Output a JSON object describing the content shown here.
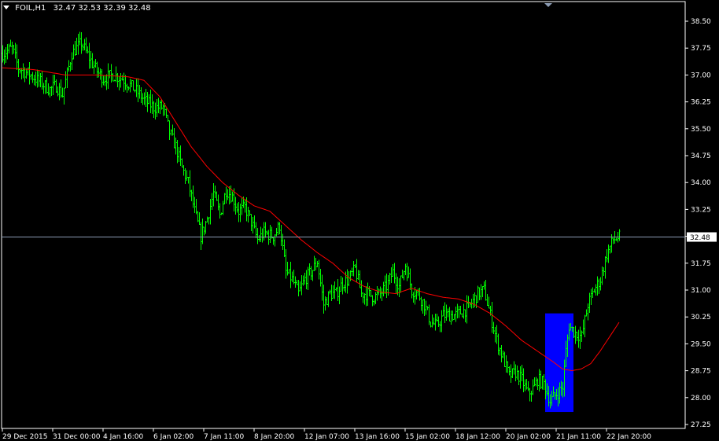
{
  "header": {
    "symbol": "FOIL,H1",
    "ohlc": "32.47 32.53 32.39 32.48"
  },
  "current_price_label": "32.48",
  "chart_data": {
    "type": "bar",
    "title": "FOIL,H1",
    "colors": {
      "bars": "#00ff00",
      "ma": "#ff0000",
      "highlight": "#0000ff",
      "axis": "#ffffff",
      "price_line": "#8c9cb4"
    },
    "y_ticks": [
      "38.50",
      "37.75",
      "37.00",
      "36.25",
      "35.50",
      "34.75",
      "34.00",
      "33.25",
      "32.50",
      "31.75",
      "31.00",
      "30.25",
      "29.50",
      "28.75",
      "28.00",
      "27.25"
    ],
    "y_tick_values": [
      38.5,
      37.75,
      37.0,
      36.25,
      35.5,
      34.75,
      34.0,
      33.25,
      32.5,
      31.75,
      31.0,
      30.25,
      29.5,
      28.75,
      28.0,
      27.25
    ],
    "x_ticks": [
      "29 Dec 2015",
      "31 Dec 00:00",
      "4 Jan 16:00",
      "6 Jan 02:00",
      "7 Jan 11:00",
      "8 Jan 20:00",
      "12 Jan 07:00",
      "13 Jan 16:00",
      "15 Jan 02:00",
      "18 Jan 12:00",
      "20 Jan 02:00",
      "21 Jan 11:00",
      "22 Jan 20:00"
    ],
    "x_tick_bar_index": [
      0,
      32,
      64,
      96,
      128,
      160,
      192,
      224,
      256,
      288,
      320,
      352,
      384
    ],
    "ylim": [
      27.1,
      38.8
    ],
    "current_price": 32.48,
    "price_anchors": [
      [
        0,
        37.6
      ],
      [
        6,
        37.75
      ],
      [
        10,
        37.2
      ],
      [
        16,
        37.05
      ],
      [
        24,
        36.8
      ],
      [
        30,
        36.6
      ],
      [
        34,
        36.7
      ],
      [
        38,
        36.45
      ],
      [
        44,
        37.6
      ],
      [
        50,
        37.9
      ],
      [
        56,
        37.4
      ],
      [
        60,
        37.1
      ],
      [
        64,
        36.9
      ],
      [
        70,
        37.0
      ],
      [
        76,
        36.9
      ],
      [
        84,
        36.6
      ],
      [
        90,
        36.3
      ],
      [
        96,
        36.1
      ],
      [
        102,
        36.1
      ],
      [
        106,
        35.4
      ],
      [
        110,
        35.0
      ],
      [
        114,
        34.4
      ],
      [
        118,
        34.0
      ],
      [
        122,
        33.2
      ],
      [
        126,
        32.5
      ],
      [
        130,
        33.0
      ],
      [
        134,
        33.7
      ],
      [
        138,
        33.1
      ],
      [
        142,
        33.8
      ],
      [
        146,
        33.6
      ],
      [
        150,
        33.2
      ],
      [
        154,
        33.3
      ],
      [
        158,
        32.9
      ],
      [
        162,
        32.4
      ],
      [
        166,
        32.6
      ],
      [
        172,
        32.5
      ],
      [
        176,
        32.8
      ],
      [
        180,
        31.5
      ],
      [
        184,
        31.3
      ],
      [
        188,
        30.9
      ],
      [
        192,
        31.3
      ],
      [
        196,
        31.5
      ],
      [
        200,
        31.8
      ],
      [
        204,
        30.6
      ],
      [
        208,
        30.9
      ],
      [
        212,
        30.9
      ],
      [
        216,
        31.2
      ],
      [
        220,
        31.3
      ],
      [
        224,
        31.6
      ],
      [
        228,
        30.9
      ],
      [
        232,
        30.9
      ],
      [
        236,
        30.8
      ],
      [
        240,
        30.9
      ],
      [
        244,
        31.1
      ],
      [
        248,
        31.5
      ],
      [
        252,
        31.1
      ],
      [
        256,
        31.7
      ],
      [
        260,
        31.0
      ],
      [
        264,
        30.9
      ],
      [
        268,
        30.6
      ],
      [
        272,
        30.1
      ],
      [
        276,
        30.0
      ],
      [
        280,
        30.3
      ],
      [
        284,
        30.3
      ],
      [
        288,
        30.3
      ],
      [
        292,
        30.4
      ],
      [
        296,
        30.5
      ],
      [
        302,
        30.9
      ],
      [
        306,
        31.0
      ],
      [
        310,
        30.3
      ],
      [
        314,
        29.6
      ],
      [
        318,
        29.1
      ],
      [
        322,
        28.6
      ],
      [
        326,
        28.7
      ],
      [
        330,
        28.5
      ],
      [
        334,
        28.1
      ],
      [
        338,
        28.3
      ],
      [
        340,
        28.5
      ],
      [
        344,
        28.4
      ],
      [
        348,
        27.9
      ],
      [
        352,
        28.1
      ],
      [
        356,
        28.3
      ],
      [
        358,
        29.3
      ],
      [
        360,
        30.0
      ],
      [
        364,
        29.8
      ],
      [
        368,
        29.7
      ],
      [
        372,
        30.6
      ],
      [
        376,
        31.0
      ],
      [
        380,
        31.3
      ],
      [
        384,
        32.0
      ],
      [
        388,
        32.4
      ],
      [
        392,
        32.48
      ]
    ],
    "ma_anchors": [
      [
        0,
        37.2
      ],
      [
        20,
        37.15
      ],
      [
        40,
        37.0
      ],
      [
        60,
        37.0
      ],
      [
        80,
        36.95
      ],
      [
        90,
        36.85
      ],
      [
        100,
        36.4
      ],
      [
        110,
        35.7
      ],
      [
        120,
        35.0
      ],
      [
        130,
        34.45
      ],
      [
        140,
        34.0
      ],
      [
        150,
        33.65
      ],
      [
        160,
        33.35
      ],
      [
        170,
        33.2
      ],
      [
        180,
        32.8
      ],
      [
        190,
        32.4
      ],
      [
        200,
        32.05
      ],
      [
        210,
        31.75
      ],
      [
        220,
        31.35
      ],
      [
        230,
        31.1
      ],
      [
        240,
        30.95
      ],
      [
        250,
        30.9
      ],
      [
        260,
        31.05
      ],
      [
        270,
        30.9
      ],
      [
        280,
        30.8
      ],
      [
        290,
        30.75
      ],
      [
        300,
        30.6
      ],
      [
        310,
        30.35
      ],
      [
        320,
        30.0
      ],
      [
        330,
        29.6
      ],
      [
        340,
        29.3
      ],
      [
        350,
        29.0
      ],
      [
        356,
        28.8
      ],
      [
        362,
        28.75
      ],
      [
        368,
        28.8
      ],
      [
        374,
        28.95
      ],
      [
        380,
        29.3
      ],
      [
        386,
        29.7
      ],
      [
        392,
        30.1
      ]
    ],
    "bar_count": 393,
    "highlight": {
      "start_bar": 345,
      "end_bar": 363,
      "low": 27.6,
      "high": 30.35
    }
  }
}
